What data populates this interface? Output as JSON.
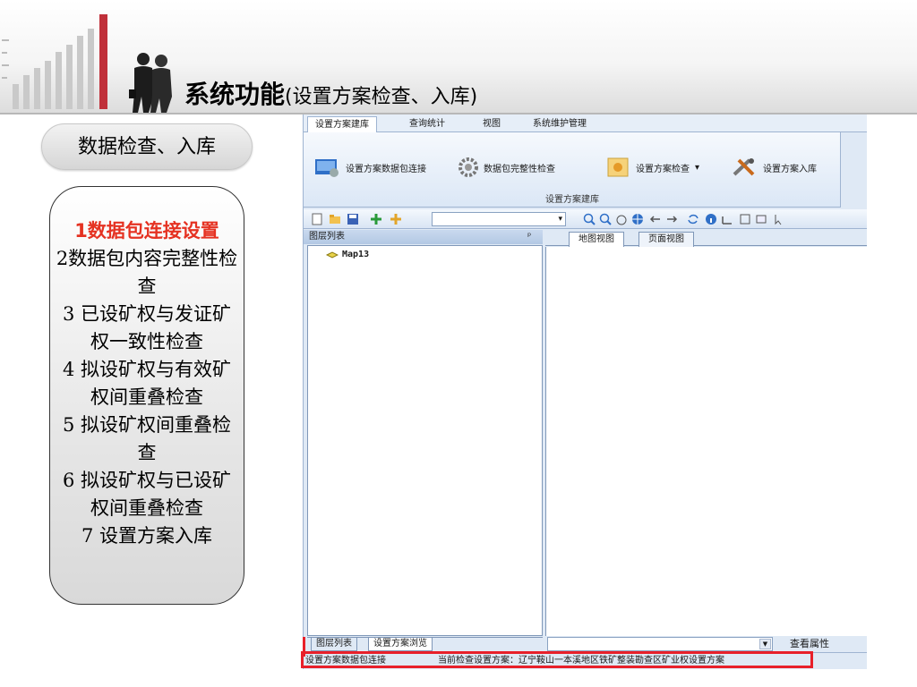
{
  "slide": {
    "title_main": "系统功能",
    "title_sub": "(设置方案检查、入库)",
    "section_pill": "数据检查、入库",
    "steps": [
      "1数据包连接设置",
      "2数据包内容完整性检查",
      "3 已设矿权与发证矿权一致性检查",
      "4 拟设矿权与有效矿权间重叠检查",
      "5 拟设矿权间重叠检查",
      "6 拟设矿权与已设矿权间重叠检查",
      "7 设置方案入库"
    ]
  },
  "colors": {
    "highlight_step": "#e53222",
    "annotation_red": "#e8202a",
    "ribbon_blue": "#dfe9f5"
  },
  "app": {
    "menu_tabs": [
      "设置方案建库",
      "查询统计",
      "视图",
      "系统维护管理"
    ],
    "ribbon_buttons": [
      {
        "label": "设置方案数据包连接",
        "icon": "db-connect-icon"
      },
      {
        "label": "数据包完整性检查",
        "icon": "gear-icon"
      },
      {
        "label": "设置方案检查",
        "icon": "check-icon"
      },
      {
        "label": "设置方案入库",
        "icon": "tools-icon"
      }
    ],
    "ribbon_group": "设置方案建库",
    "left_panel_title": "图层列表",
    "left_panel_pin": "ᵖ",
    "tree_item": "Map13",
    "view_tabs": [
      "地图视图",
      "页面视图"
    ],
    "bottom_tabs": [
      "图层列表",
      "设置方案浏览"
    ],
    "view_properties": "查看属性",
    "status_left": "设置方案数据包连接",
    "status_current": "当前检查设置方案：辽宁鞍山一本溪地区铁矿整装勘查区矿业权设置方案"
  }
}
